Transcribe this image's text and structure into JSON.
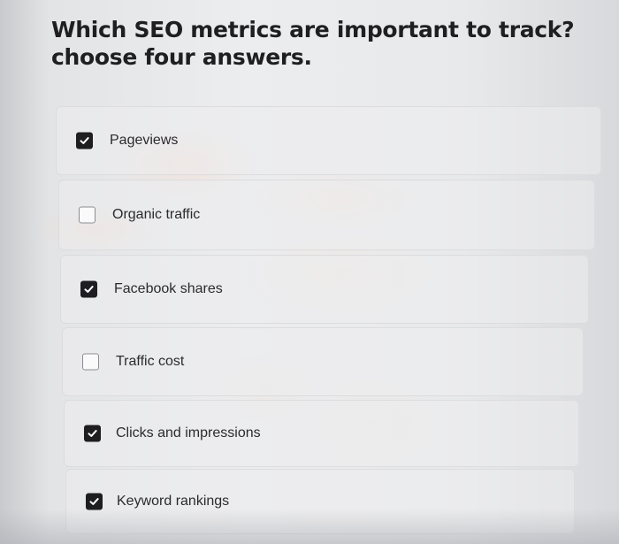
{
  "question": {
    "line1": "Which SEO metrics are important to track?",
    "line2": "choose four answers."
  },
  "options": [
    {
      "label": "Pageviews",
      "checked": true
    },
    {
      "label": "Organic traffic",
      "checked": false
    },
    {
      "label": "Facebook shares",
      "checked": true
    },
    {
      "label": "Traffic cost",
      "checked": false
    },
    {
      "label": "Clicks and impressions",
      "checked": true
    },
    {
      "label": "Keyword rankings",
      "checked": true
    }
  ]
}
